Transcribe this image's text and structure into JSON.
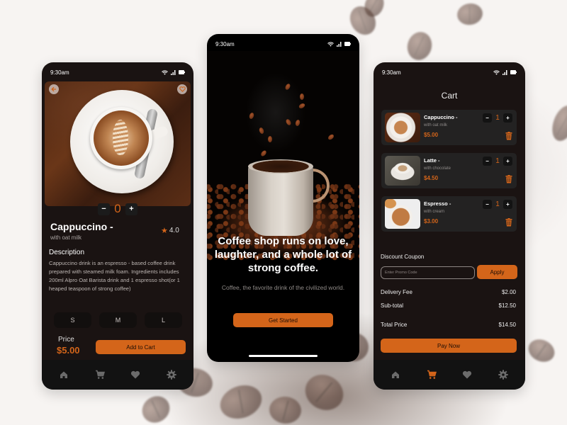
{
  "status_bar": {
    "time": "9:30am"
  },
  "product_screen": {
    "quantity": "0",
    "name": "Cappuccino -",
    "subtitle": "with oat milk",
    "rating": "4.0",
    "description_title": "Description",
    "description": "Cappuccino drink is an espresso - based coffee drink prepared with steamed milk foam. Ingredients includes 200ml Alpro Oat Barista drink and 1 espresso shot(or 1 heaped teaspoon of strong coffee)",
    "sizes": [
      "S",
      "M",
      "L"
    ],
    "price_label": "Price",
    "price": "$5.00",
    "add_to_cart_label": "Add to Cart",
    "minus_label": "−",
    "plus_label": "+"
  },
  "splash_screen": {
    "headline": "Coffee shop runs on love, laughter, and a whole lot of strong coffee.",
    "subtitle": "Coffee, the favorite drink of the civilized world.",
    "cta_label": "Get Started"
  },
  "cart_screen": {
    "title": "Cart",
    "items": [
      {
        "name": "Cappuccino -",
        "subtitle": "with oat milk",
        "price": "$5.00",
        "quantity": "1"
      },
      {
        "name": "Latte -",
        "subtitle": "with chocolate",
        "price": "$4.50",
        "quantity": "1"
      },
      {
        "name": "Espresso -",
        "subtitle": "with cream",
        "price": "$3.00",
        "quantity": "1"
      }
    ],
    "coupon_label": "Discount Coupon",
    "promo_placeholder": "Enter Promo Code",
    "apply_label": "Apply",
    "delivery_fee_label": "Delivery Fee",
    "delivery_fee": "$2.00",
    "subtotal_label": "Sub-total",
    "subtotal": "$12.50",
    "total_label": "Total Price",
    "total": "$14.50",
    "pay_label": "Pay Now"
  },
  "nav": {
    "items": [
      "home",
      "cart",
      "favorites",
      "settings"
    ],
    "product_active": "",
    "cart_active": "cart"
  },
  "colors": {
    "accent": "#d4651a",
    "phone_bg": "#1a1312",
    "card_bg": "#232222",
    "nav_bg": "#121212",
    "nav_icon_inactive": "#6b6b6b"
  }
}
